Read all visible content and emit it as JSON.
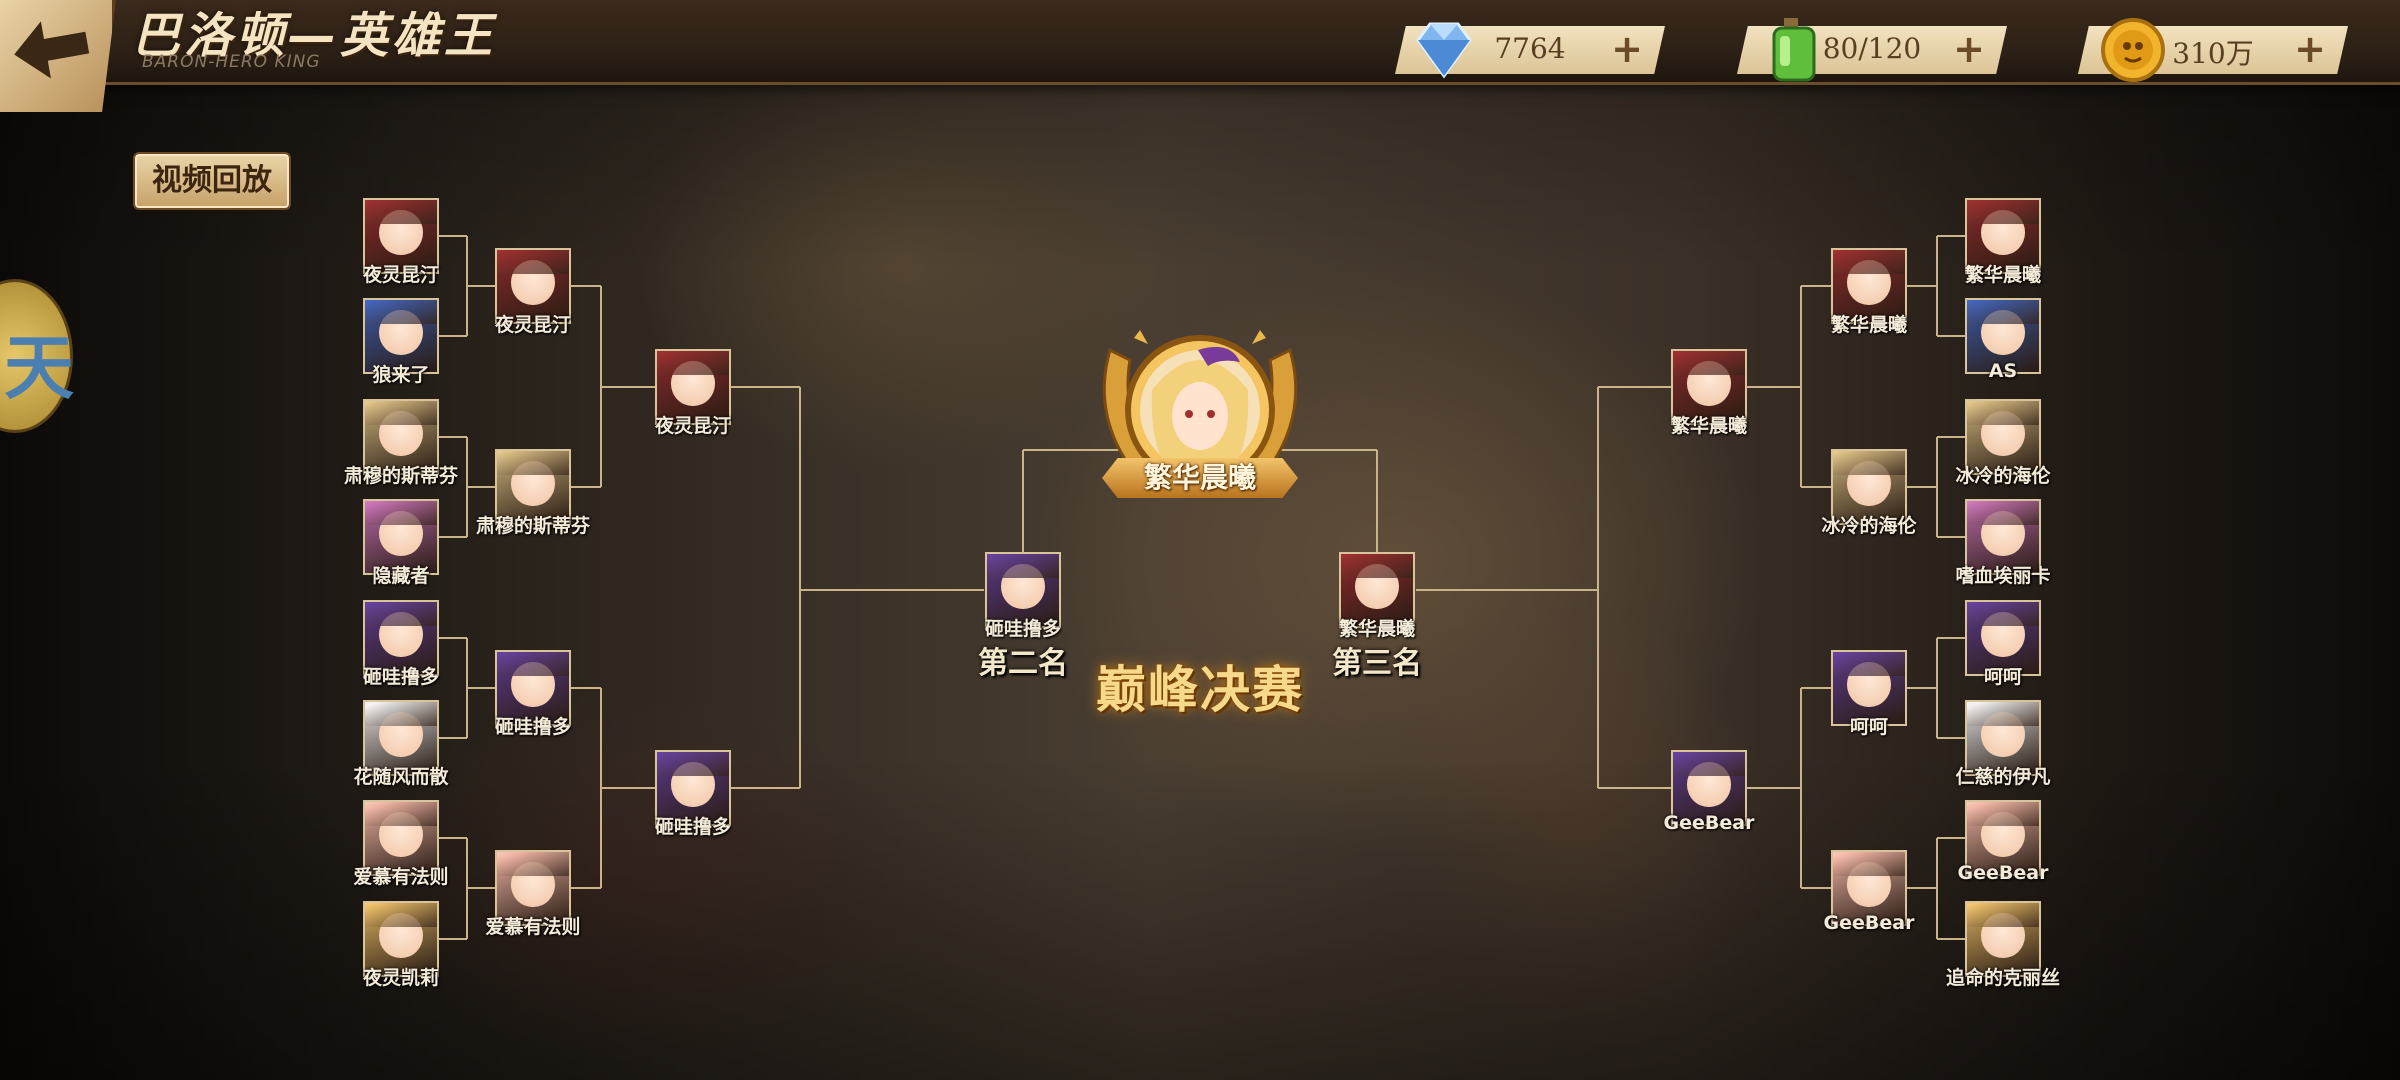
{
  "header": {
    "title": "巴洛顿—英雄王",
    "subtitle": "BARON-HERO KING"
  },
  "resources": [
    {
      "name": "diamond",
      "icon": "diamond-icon",
      "value": "7764",
      "plus": "+"
    },
    {
      "name": "stamina",
      "icon": "potion-icon",
      "value": "80/120",
      "plus": "+"
    },
    {
      "name": "gold",
      "icon": "coin-icon",
      "value": "310万",
      "plus": "+"
    }
  ],
  "replay_label": "视频回放",
  "side_tab_label": "天",
  "final": {
    "title": "巅峰决赛",
    "champion": "繁华晨曦",
    "runner_up": {
      "name": "砸哇撸多",
      "rank": "第二名"
    },
    "third": {
      "name": "繁华晨曦",
      "rank": "第三名"
    }
  },
  "left_bracket": {
    "round1": [
      "夜灵昆汀",
      "狼来了",
      "肃穆的斯蒂芬",
      "隐藏者",
      "砸哇撸多",
      "花随风而散",
      "爱慕有法则",
      "夜灵凯莉"
    ],
    "round2": [
      "夜灵昆汀",
      "肃穆的斯蒂芬",
      "砸哇撸多",
      "爱慕有法则"
    ],
    "round3": [
      "夜灵昆汀",
      "砸哇撸多"
    ]
  },
  "right_bracket": {
    "round1": [
      "繁华晨曦",
      "AS",
      "冰冷的海伦",
      "嗜血埃丽卡",
      "呵呵",
      "仁慈的伊凡",
      "GeeBear",
      "追命的克丽丝"
    ],
    "round2": [
      "繁华晨曦",
      "冰冷的海伦",
      "呵呵",
      "GeeBear"
    ],
    "round3": [
      "繁华晨曦",
      "GeeBear"
    ]
  },
  "colors": {
    "bracket_line": "#c9b48a",
    "accent_gold": "#f6d98a"
  }
}
